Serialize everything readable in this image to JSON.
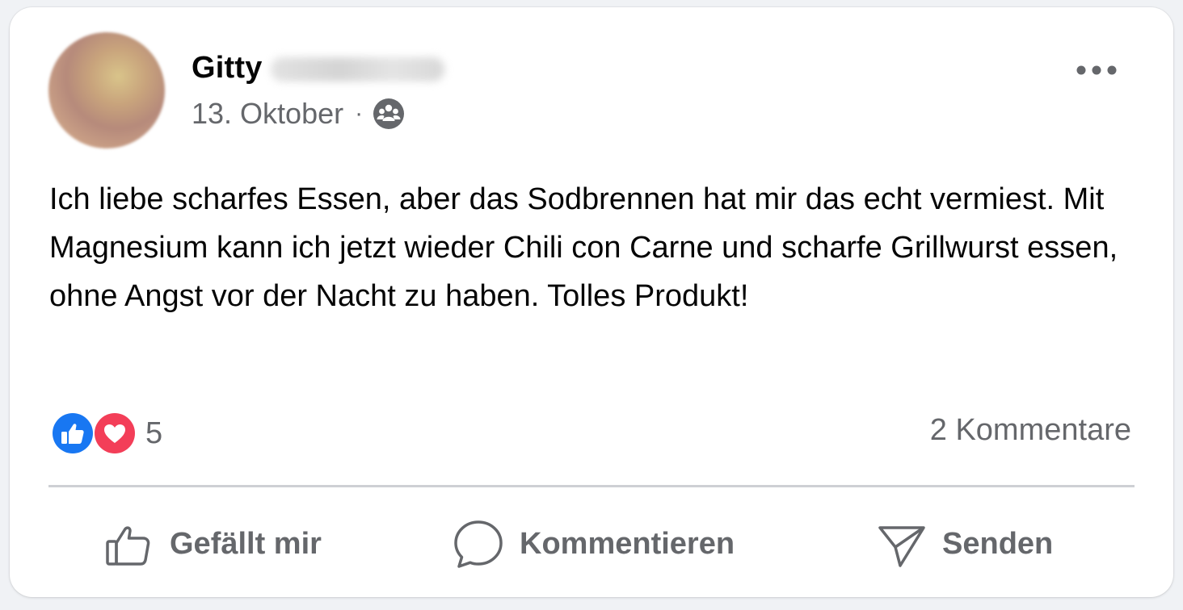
{
  "post": {
    "author_first_name": "Gitty",
    "date": "13. Oktober",
    "separator": "·",
    "audience_icon": "friends-icon",
    "body": "Ich liebe scharfes Essen, aber das Sodbrennen hat mir das echt vermiest. Mit Magnesium kann ich jetzt wieder Chili con Carne und scharfe Grillwurst essen, ohne Angst vor der Nacht zu haben. Tolles Produkt!"
  },
  "reactions": {
    "types": [
      "like-reaction-icon",
      "love-reaction-icon"
    ],
    "count": "5"
  },
  "comments": {
    "label": "2 Kommentare"
  },
  "actions": {
    "like_label": "Gefällt mir",
    "comment_label": "Kommentieren",
    "send_label": "Senden"
  },
  "colors": {
    "like_blue": "#1877f2",
    "love_red": "#f33e58",
    "secondary_text": "#65676b",
    "divider": "#ced0d4"
  }
}
